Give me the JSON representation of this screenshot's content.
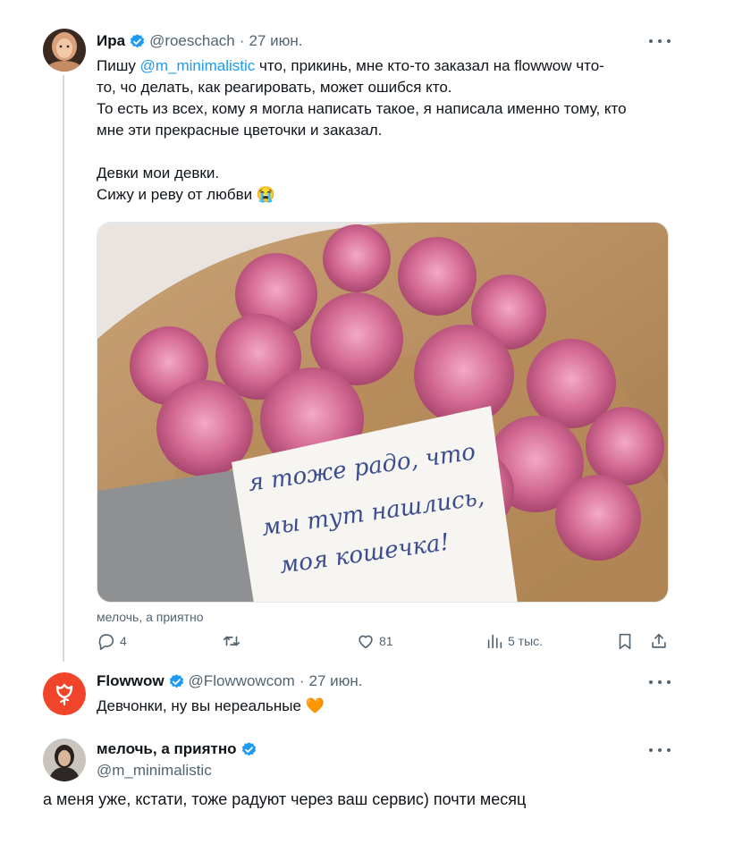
{
  "tweet1": {
    "name": "Ира",
    "handle": "@roeschach",
    "separator": "·",
    "date": "27 июн.",
    "lines": [
      {
        "before": "Пишу ",
        "mention": "@m_minimalistic",
        "after": " что, прикинь, мне кто-то заказал на flowwow что-"
      },
      {
        "text": "то, чо делать, как реагировать, может ошибся кто."
      },
      {
        "text": "То есть из всех, кому я могла написать такое, я написала именно тому, кто"
      },
      {
        "text": "мне эти прекрасные цветочки и заказал."
      },
      {
        "text": ""
      },
      {
        "text": "Девки мои девки."
      },
      {
        "text": "Сижу и реву от любви 😭"
      }
    ],
    "photo_note_lines": [
      "я тоже радо, что",
      "мы тут нашлись,",
      "моя кошечка!"
    ],
    "caption": "мелочь, а приятно",
    "stats": {
      "replies": "4",
      "likes": "81",
      "views": "5 тыс."
    },
    "icons": [
      "reply-icon",
      "retweet-icon",
      "like-icon",
      "views-icon",
      "bookmark-icon",
      "share-icon",
      "more-icon"
    ]
  },
  "tweet2": {
    "name": "Flowwow",
    "handle": "@Flowwowcom",
    "separator": "·",
    "date": "27 июн.",
    "text_before": "Девчонки, ну вы нереальные ",
    "emoji": "🧡",
    "brand_color": "#f0452b"
  },
  "tweet3": {
    "name": "мелочь, а приятно",
    "handle": "@m_minimalistic",
    "text": "а меня уже, кстати, тоже радуют через ваш сервис) почти месяц"
  },
  "colors": {
    "accent": "#1d9bf0",
    "muted": "#536471",
    "text": "#0f1419"
  }
}
